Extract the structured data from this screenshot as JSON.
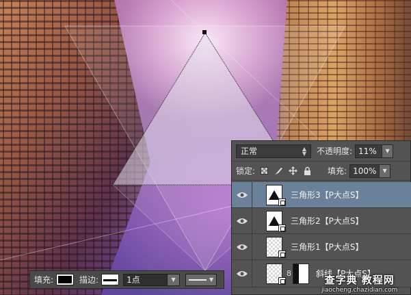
{
  "layers_panel": {
    "blend_mode": "正常",
    "opacity_label": "不透明度:",
    "opacity_value": "11%",
    "lock_label": "锁定:",
    "fill_label": "填充:",
    "fill_value": "100%",
    "layers": [
      {
        "name": "三角形3【P大点S】",
        "selected": true
      },
      {
        "name": "三角形2【P大点S】",
        "selected": false
      },
      {
        "name": "三角形1【P大点S】",
        "selected": false
      },
      {
        "name": "斜线【P大点S】",
        "selected": false
      }
    ]
  },
  "options_bar": {
    "fill_label": "填充:",
    "stroke_label": "描边:",
    "stroke_width": "1点"
  },
  "watermark": {
    "title": "查字典 教程网",
    "url": "jiaocheng.chazidian.com"
  },
  "colors": {
    "panel_bg": "#535353",
    "selected_row": "#6b8099",
    "panel_text": "#e6e6e6"
  }
}
